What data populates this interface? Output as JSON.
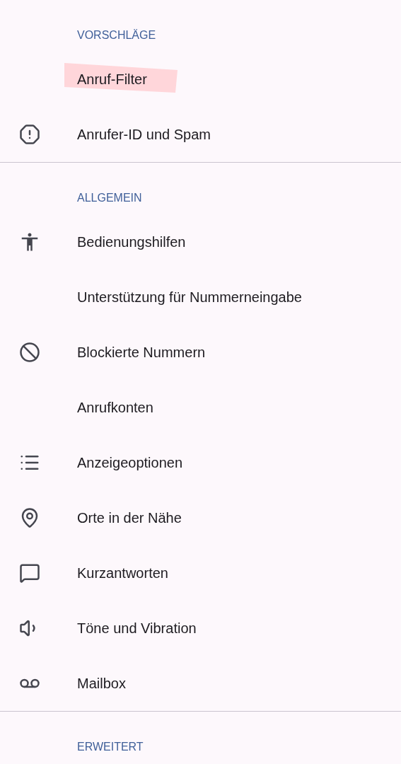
{
  "sections": [
    {
      "header": "VORSCHLÄGE",
      "items": [
        {
          "label": "Anruf-Filter",
          "kind": "none",
          "highlighted": true
        },
        {
          "label": "Anrufer-ID und Spam",
          "kind": "alert",
          "highlighted": false
        }
      ]
    },
    {
      "header": "ALLGEMEIN",
      "items": [
        {
          "label": "Bedienungshilfen",
          "kind": "accessibility",
          "highlighted": false
        },
        {
          "label": "Unterstützung für Nummerneingabe",
          "kind": "none",
          "highlighted": false
        },
        {
          "label": "Blockierte Nummern",
          "kind": "block",
          "highlighted": false
        },
        {
          "label": "Anrufkonten",
          "kind": "none",
          "highlighted": false
        },
        {
          "label": "Anzeigeoptionen",
          "kind": "list",
          "highlighted": false
        },
        {
          "label": "Orte in der Nähe",
          "kind": "location",
          "highlighted": false
        },
        {
          "label": "Kurzantworten",
          "kind": "message",
          "highlighted": false
        },
        {
          "label": "Töne und Vibration",
          "kind": "sound",
          "highlighted": false
        },
        {
          "label": "Mailbox",
          "kind": "voicemail",
          "highlighted": false
        }
      ]
    },
    {
      "header": "ERWEITERT"
    }
  ]
}
